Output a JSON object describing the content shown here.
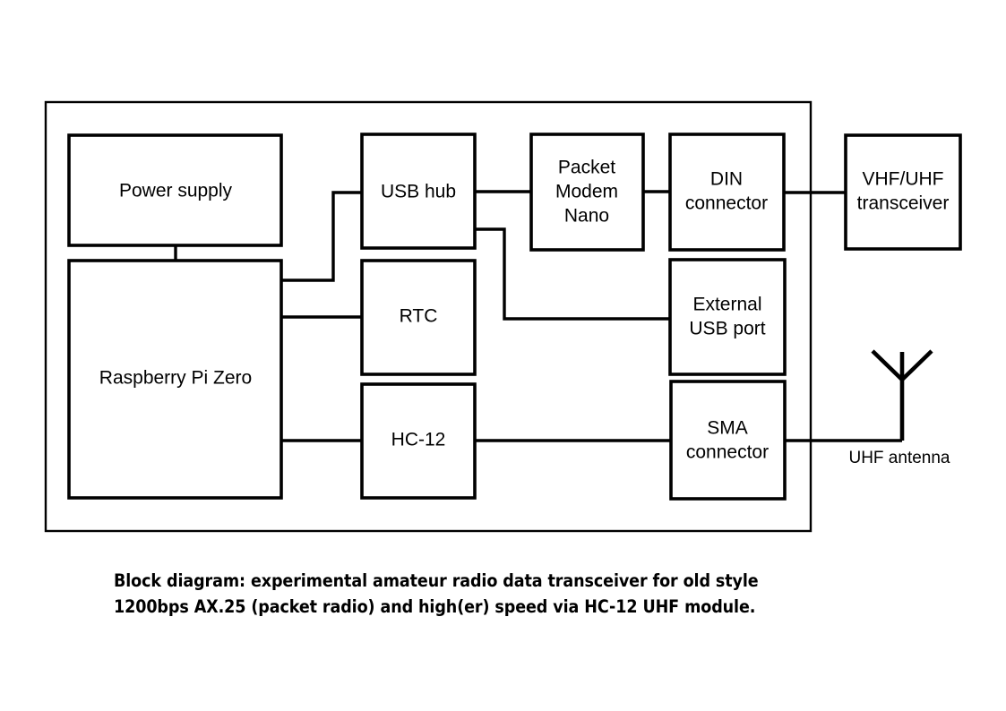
{
  "diagram": {
    "title": "Block diagram: experimental amateur radio data transceiver",
    "enclosure_label": "",
    "blocks": {
      "power_supply": "Power supply",
      "raspberry_pi": "Raspberry Pi Zero",
      "usb_hub": "USB hub",
      "rtc": "RTC",
      "hc12": "HC-12",
      "packet_modem_line1": "Packet",
      "packet_modem_line2": "Modem",
      "packet_modem_line3": "Nano",
      "din_connector_line1": "DIN",
      "din_connector_line2": "connector",
      "external_usb_line1": "External",
      "external_usb_line2": "USB port",
      "sma_connector_line1": "SMA",
      "sma_connector_line2": "connector",
      "transceiver_line1": "VHF/UHF",
      "transceiver_line2": "transceiver"
    },
    "annotations": {
      "uhf_antenna": "UHF antenna"
    },
    "caption": "Block diagram: experimental amateur radio data transceiver for old style\n1200bps AX.25 (packet radio) and high(er) speed via HC-12 UHF module.",
    "colors": {
      "stroke": "#000000",
      "background": "#ffffff"
    }
  }
}
